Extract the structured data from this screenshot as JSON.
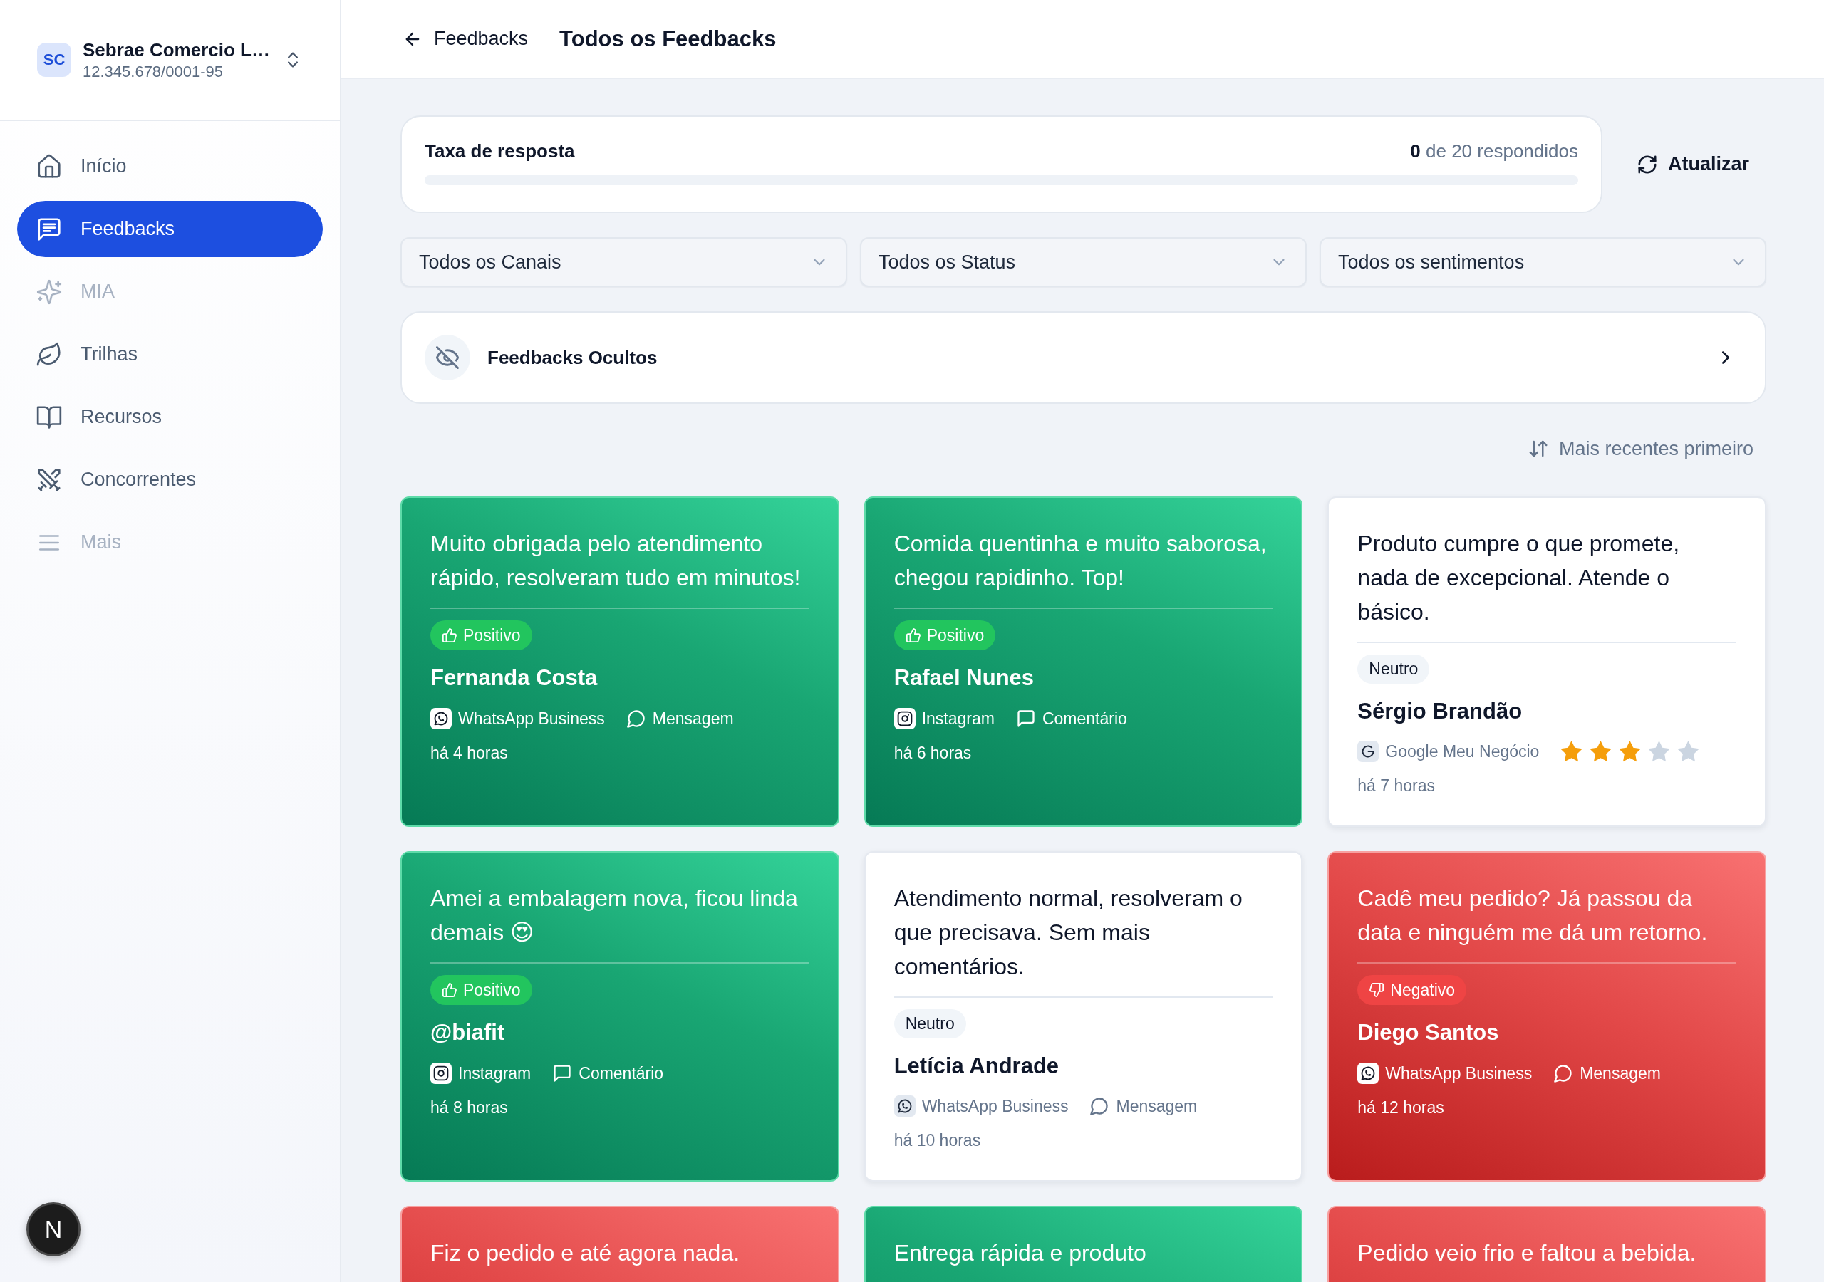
{
  "sidebar": {
    "company": {
      "initials": "SC",
      "name": "Sebrae Comercio L…",
      "document": "12.345.678/0001-95"
    },
    "nav": [
      {
        "label": "Início",
        "selected": false,
        "disabled": false
      },
      {
        "label": "Feedbacks",
        "selected": true,
        "disabled": false
      },
      {
        "label": "MIA",
        "selected": false,
        "disabled": true
      },
      {
        "label": "Trilhas",
        "selected": false,
        "disabled": false
      },
      {
        "label": "Recursos",
        "selected": false,
        "disabled": false
      },
      {
        "label": "Concorrentes",
        "selected": false,
        "disabled": false
      },
      {
        "label": "Mais",
        "selected": false,
        "disabled": true
      }
    ]
  },
  "header": {
    "back": "Feedbacks",
    "title": "Todos os Feedbacks"
  },
  "response": {
    "title": "Taxa de resposta",
    "count": "**0** de 20 respondidos",
    "level": 0
  },
  "refresh": {
    "label": "Atualizar"
  },
  "filters": [
    {
      "value": "Todos os Canais"
    },
    {
      "value": "Todos os Status"
    },
    {
      "value": "Todos os sentimentos"
    }
  ],
  "hidden": {
    "label": "Feedbacks Ocultos"
  },
  "sort": {
    "label": "Mais recentes primeiro"
  },
  "cards": [
    {
      "kind": "positive",
      "text": "Muito obrigada pelo atendimento rápido, resolveram tudo em minutos!",
      "badge": "Positivo",
      "author": "Fernanda Costa",
      "channel": {
        "kind": "whatsapp",
        "label": "WhatsApp Business"
      },
      "type": {
        "kind": "message",
        "label": "Mensagem"
      },
      "time": "há 4 horas"
    },
    {
      "kind": "positive",
      "text": "Comida quentinha e muito saborosa, chegou rapidinho. Top!",
      "badge": "Positivo",
      "author": "Rafael Nunes",
      "channel": {
        "kind": "instagram",
        "label": "Instagram"
      },
      "type": {
        "kind": "comment",
        "label": "Comentário"
      },
      "time": "há 6 horas"
    },
    {
      "kind": "neutral",
      "text": "Produto cumpre o que promete, nada de excepcional. Atende o básico.",
      "badge": "Neutro",
      "author": "Sérgio Brandão",
      "channel": {
        "kind": "google",
        "label": "Google Meu Negócio"
      },
      "stars": 3,
      "time": "há 7 horas"
    },
    {
      "kind": "positive",
      "text": "Amei a embalagem nova, ficou linda demais 😍",
      "badge": "Positivo",
      "author": "@biafit",
      "channel": {
        "kind": "instagram",
        "label": "Instagram"
      },
      "type": {
        "kind": "comment",
        "label": "Comentário"
      },
      "time": "há 8 horas"
    },
    {
      "kind": "neutral",
      "text": "Atendimento normal, resolveram o que precisava. Sem mais comentários.",
      "badge": "Neutro",
      "author": "Letícia Andrade",
      "channel": {
        "kind": "whatsapp",
        "label": "WhatsApp Business"
      },
      "type": {
        "kind": "message",
        "label": "Mensagem"
      },
      "time": "há 10 horas"
    },
    {
      "kind": "negative",
      "text": "Cadê meu pedido? Já passou da data e ninguém me dá um retorno.",
      "badge": "Negativo",
      "author": "Diego Santos",
      "channel": {
        "kind": "whatsapp",
        "label": "WhatsApp Business"
      },
      "type": {
        "kind": "message",
        "label": "Mensagem"
      },
      "time": "há 12 horas"
    },
    {
      "kind": "negative",
      "text": "Fiz o pedido e até agora nada."
    },
    {
      "kind": "positive",
      "text": "Entrega rápida e produto"
    },
    {
      "kind": "negative",
      "text": "Pedido veio frio e faltou a bebida."
    }
  ],
  "dev_badge": {
    "label": "N"
  }
}
